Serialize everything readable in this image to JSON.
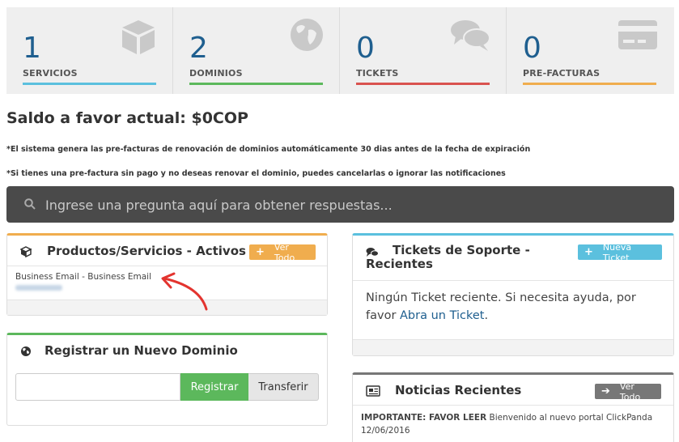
{
  "stats": [
    {
      "value": "1",
      "label": "SERVICIOS",
      "color": "#5bc0de",
      "icon": "cube-icon"
    },
    {
      "value": "2",
      "label": "DOMINIOS",
      "color": "#5cb85c",
      "icon": "globe-icon"
    },
    {
      "value": "0",
      "label": "TICKETS",
      "color": "#d9534f",
      "icon": "comments-icon"
    },
    {
      "value": "0",
      "label": "PRE-FACTURAS",
      "color": "#f0ad4e",
      "icon": "credit-card-icon"
    }
  ],
  "saldo": "Saldo a favor actual: $0COP",
  "notes": [
    "*El sistema genera las pre-facturas de renovación de dominios automáticamente 30 dias antes de la fecha de expiración",
    "*Si tienes una pre-factura sin pago y no deseas renovar el dominio, puedes cancelarlas o ignorar las notificaciones"
  ],
  "search": {
    "placeholder": "Ingrese una pregunta aquí para obtener respuestas..."
  },
  "products": {
    "title": "Productos/Servicios - Activos",
    "button": "Ver Todo",
    "item": "Business Email - Business Email",
    "color": "#f0ad4e"
  },
  "domain": {
    "title": "Registrar un Nuevo Dominio",
    "register": "Registrar",
    "transfer": "Transferir",
    "color": "#5cb85c"
  },
  "tickets": {
    "title_line1": "Tickets de Soporte -",
    "title_line2": "Recientes",
    "button": "Nueva Ticket",
    "text": "Ningún Ticket reciente. Si necesita ayuda, por favor",
    "link": "Abra un Ticket",
    "color": "#5bc0de"
  },
  "news": {
    "title": "Noticias Recientes",
    "button": "Ver Todo",
    "headline": "IMPORTANTE: FAVOR LEER",
    "body": "Bienvenido al nuevo portal ClickPanda",
    "date": "12/06/2016",
    "color": "#777777"
  }
}
